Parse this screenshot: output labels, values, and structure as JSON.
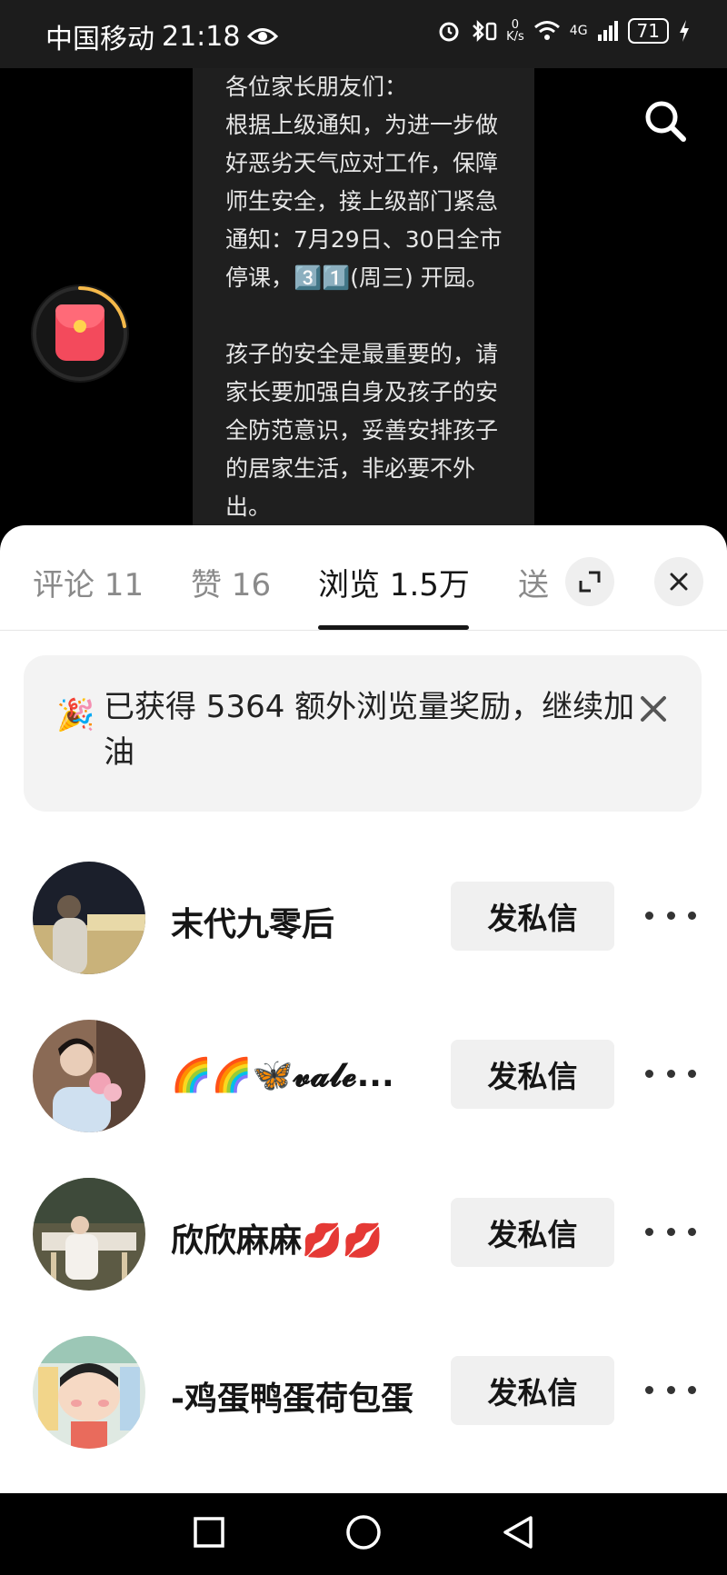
{
  "status_bar": {
    "carrier": "中国移动",
    "time": "21:18",
    "net_speed_value": "0",
    "net_speed_unit": "K/s",
    "network": "4G",
    "battery": "71"
  },
  "notice": {
    "text": "各位家长朋友们：\n根据上级通知，为进一步做好恶劣天气应对工作，保障师生安全，接上级部门紧急通知：7月29日、30日全市停课，3️⃣1️⃣(周三) 开园。\n\n孩子的安全是最重要的，请家长要加强自身及孩子的安全防范意识，妥善安排孩子的居家生活，非必要不外出。"
  },
  "tabs": [
    {
      "label": "评论 11"
    },
    {
      "label": "赞 16"
    },
    {
      "label": "浏览 1.5万"
    },
    {
      "label": "送"
    }
  ],
  "banner": {
    "emoji": "🎉",
    "text": "已获得 5364 额外浏览量奖励，继续加油"
  },
  "users": [
    {
      "name": "末代九零后",
      "button": "发私信"
    },
    {
      "name": "🌈🌈🦋𝓿𝓪𝓵𝓮...",
      "button": "发私信"
    },
    {
      "name": "欣欣麻麻💋💋",
      "button": "发私信"
    },
    {
      "name": "-鸡蛋鸭蛋荷包蛋",
      "button": "发私信"
    }
  ],
  "colors": {
    "accent_red": "#f34a5c",
    "tab_active": "#161616",
    "tab_inactive": "#8a8a8a"
  }
}
